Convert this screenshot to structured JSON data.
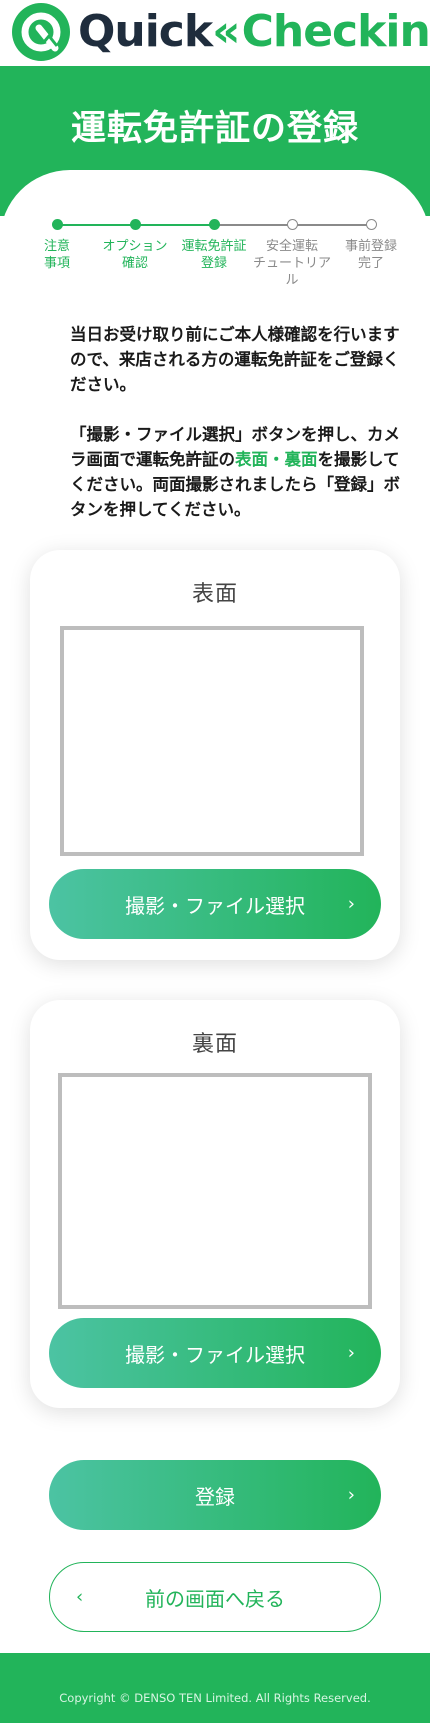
{
  "brand": {
    "name_part1": "Quick",
    "name_part2": "Checkin",
    "primary_color": "#22b45a",
    "dark_color": "#1f2d3d"
  },
  "header": {
    "title": "運転免許証の登録"
  },
  "steps": [
    {
      "line1": "注意",
      "line2": "事項",
      "state": "done"
    },
    {
      "line1": "オプション",
      "line2": "確認",
      "state": "done"
    },
    {
      "line1": "運転免許証",
      "line2": "登録",
      "state": "done"
    },
    {
      "line1": "安全運転",
      "line2": "チュートリアル",
      "state": "todo"
    },
    {
      "line1": "事前登録",
      "line2": "完了",
      "state": "todo"
    }
  ],
  "instructions": {
    "para1": "当日お受け取り前にご本人様確認を行いますので、来店される方の運転免許証をご登録ください。",
    "para2_before": "「撮影・ファイル選択」ボタンを押し、カメラ画面で運転免許証の",
    "para2_highlight": "表面・裏面",
    "para2_after": "を撮影してください。両面撮影されましたら「登録」ボタンを押してください。"
  },
  "front_card": {
    "title": "表面",
    "button_label": "撮影・ファイル選択"
  },
  "back_card": {
    "title": "裏面",
    "button_label": "撮影・ファイル選択"
  },
  "actions": {
    "register_label": "登録",
    "back_label": "前の画面へ戻る"
  },
  "footer": {
    "copyright": "Copyright © DENSO TEN Limited. All Rights Reserved."
  }
}
